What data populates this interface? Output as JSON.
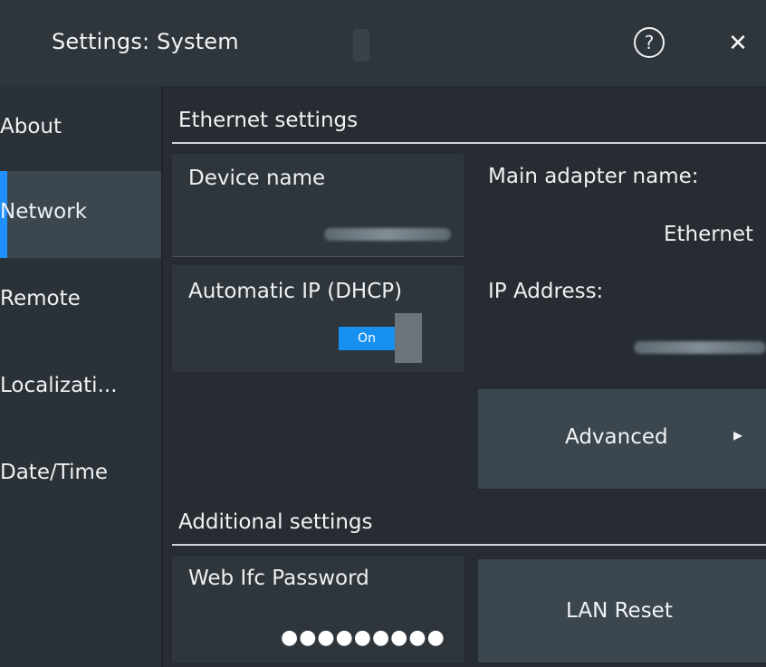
{
  "window": {
    "title": "Settings: System",
    "help_glyph": "?",
    "close_glyph": "✕",
    "icons": [
      "help-icon",
      "close-icon",
      "chevron-right-icon"
    ]
  },
  "sidebar": {
    "items": [
      {
        "label": "About",
        "active": false
      },
      {
        "label": "Network",
        "active": true
      },
      {
        "label": "Remote",
        "active": false
      },
      {
        "label": "Localizati...",
        "active": false
      },
      {
        "label": "Date/Time",
        "active": false
      }
    ]
  },
  "ethernet": {
    "heading": "Ethernet settings",
    "device_name_label": "Device name",
    "dhcp_label": "Automatic IP (DHCP)",
    "dhcp_state": "On",
    "main_adapter_label": "Main adapter name:",
    "main_adapter_value": "Ethernet",
    "ip_label": "IP Address:",
    "advanced_label": "Advanced",
    "advanced_arrow": "▸"
  },
  "additional": {
    "heading": "Additional settings",
    "web_pw_label": "Web Ifc Password",
    "web_pw_value": "●●●●●●●●●",
    "lan_reset_label": "LAN Reset"
  },
  "colors": {
    "accent": "#1e90ff",
    "toggle_on": "#1790ef",
    "background": "#262c31",
    "panel": "#2e353b",
    "button": "#3c464e"
  }
}
